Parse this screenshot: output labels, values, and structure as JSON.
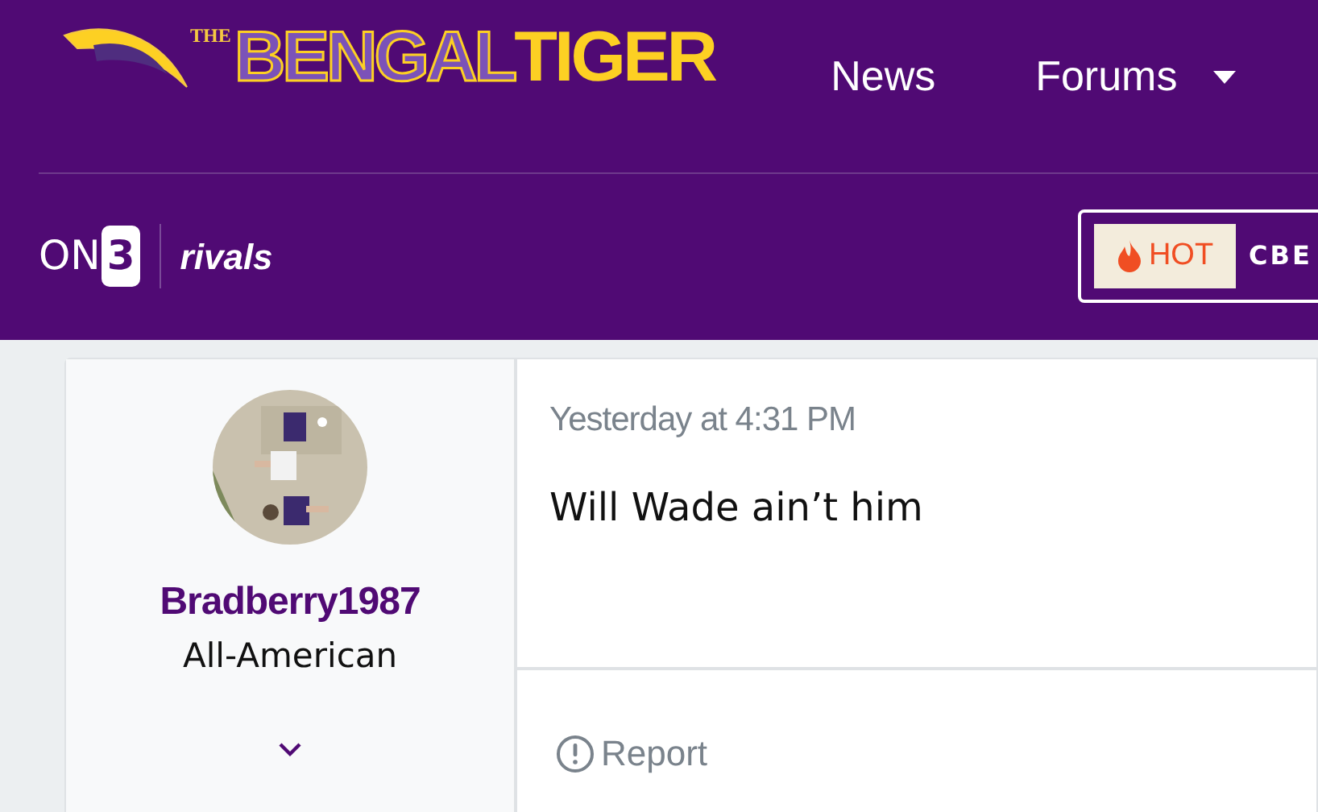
{
  "brand": {
    "the": "THE",
    "bengal": "BENGAL",
    "tiger": "TIGER"
  },
  "nav": [
    {
      "label": "News",
      "dropdown": false
    },
    {
      "label": "Forums",
      "dropdown": true
    }
  ],
  "partners": {
    "on": "ON",
    "three": "3",
    "rivals": "rivals"
  },
  "ticker": {
    "badge": "HOT",
    "text": "CBE"
  },
  "post": {
    "author": "Bradberry1987",
    "title": "All-American",
    "time": "Yesterday at 4:31 PM",
    "body": "Will Wade ain’t him",
    "actions": [
      {
        "label": "Report"
      }
    ]
  }
}
